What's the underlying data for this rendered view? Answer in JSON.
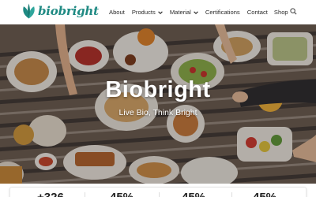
{
  "header": {
    "logo_text": "biobright",
    "nav": [
      {
        "label": "About",
        "has_dropdown": false
      },
      {
        "label": "Products",
        "has_dropdown": true
      },
      {
        "label": "Material",
        "has_dropdown": true
      },
      {
        "label": "Certifications",
        "has_dropdown": false
      },
      {
        "label": "Contact",
        "has_dropdown": false
      },
      {
        "label": "Shop",
        "has_dropdown": false
      }
    ],
    "search_icon": "search-icon"
  },
  "hero": {
    "title": "Biobright",
    "subtitle": "Live Bio, Think Bright"
  },
  "stats": [
    {
      "value": "+326"
    },
    {
      "value": "45%"
    },
    {
      "value": "45%"
    },
    {
      "value": "45%"
    }
  ],
  "colors": {
    "brand": "#1f8a83",
    "nav_text": "#2b2b2b",
    "hero_text": "#ffffff"
  }
}
